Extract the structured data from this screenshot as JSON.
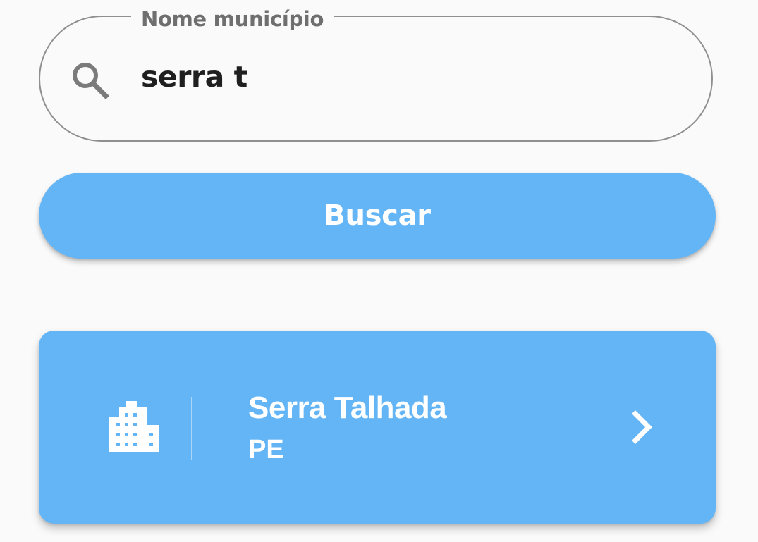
{
  "search": {
    "label": "Nome município",
    "value": "serra t",
    "icon": "search-icon"
  },
  "button": {
    "label": "Buscar"
  },
  "results": [
    {
      "city": "Serra Talhada",
      "state": "PE",
      "icon": "building-icon",
      "action_icon": "chevron-right-icon"
    }
  ],
  "colors": {
    "accent": "#64b5f6",
    "background": "#fafafa",
    "outline": "#8f8f8f",
    "label": "#6f6f6f",
    "text": "#1f1f1f"
  }
}
